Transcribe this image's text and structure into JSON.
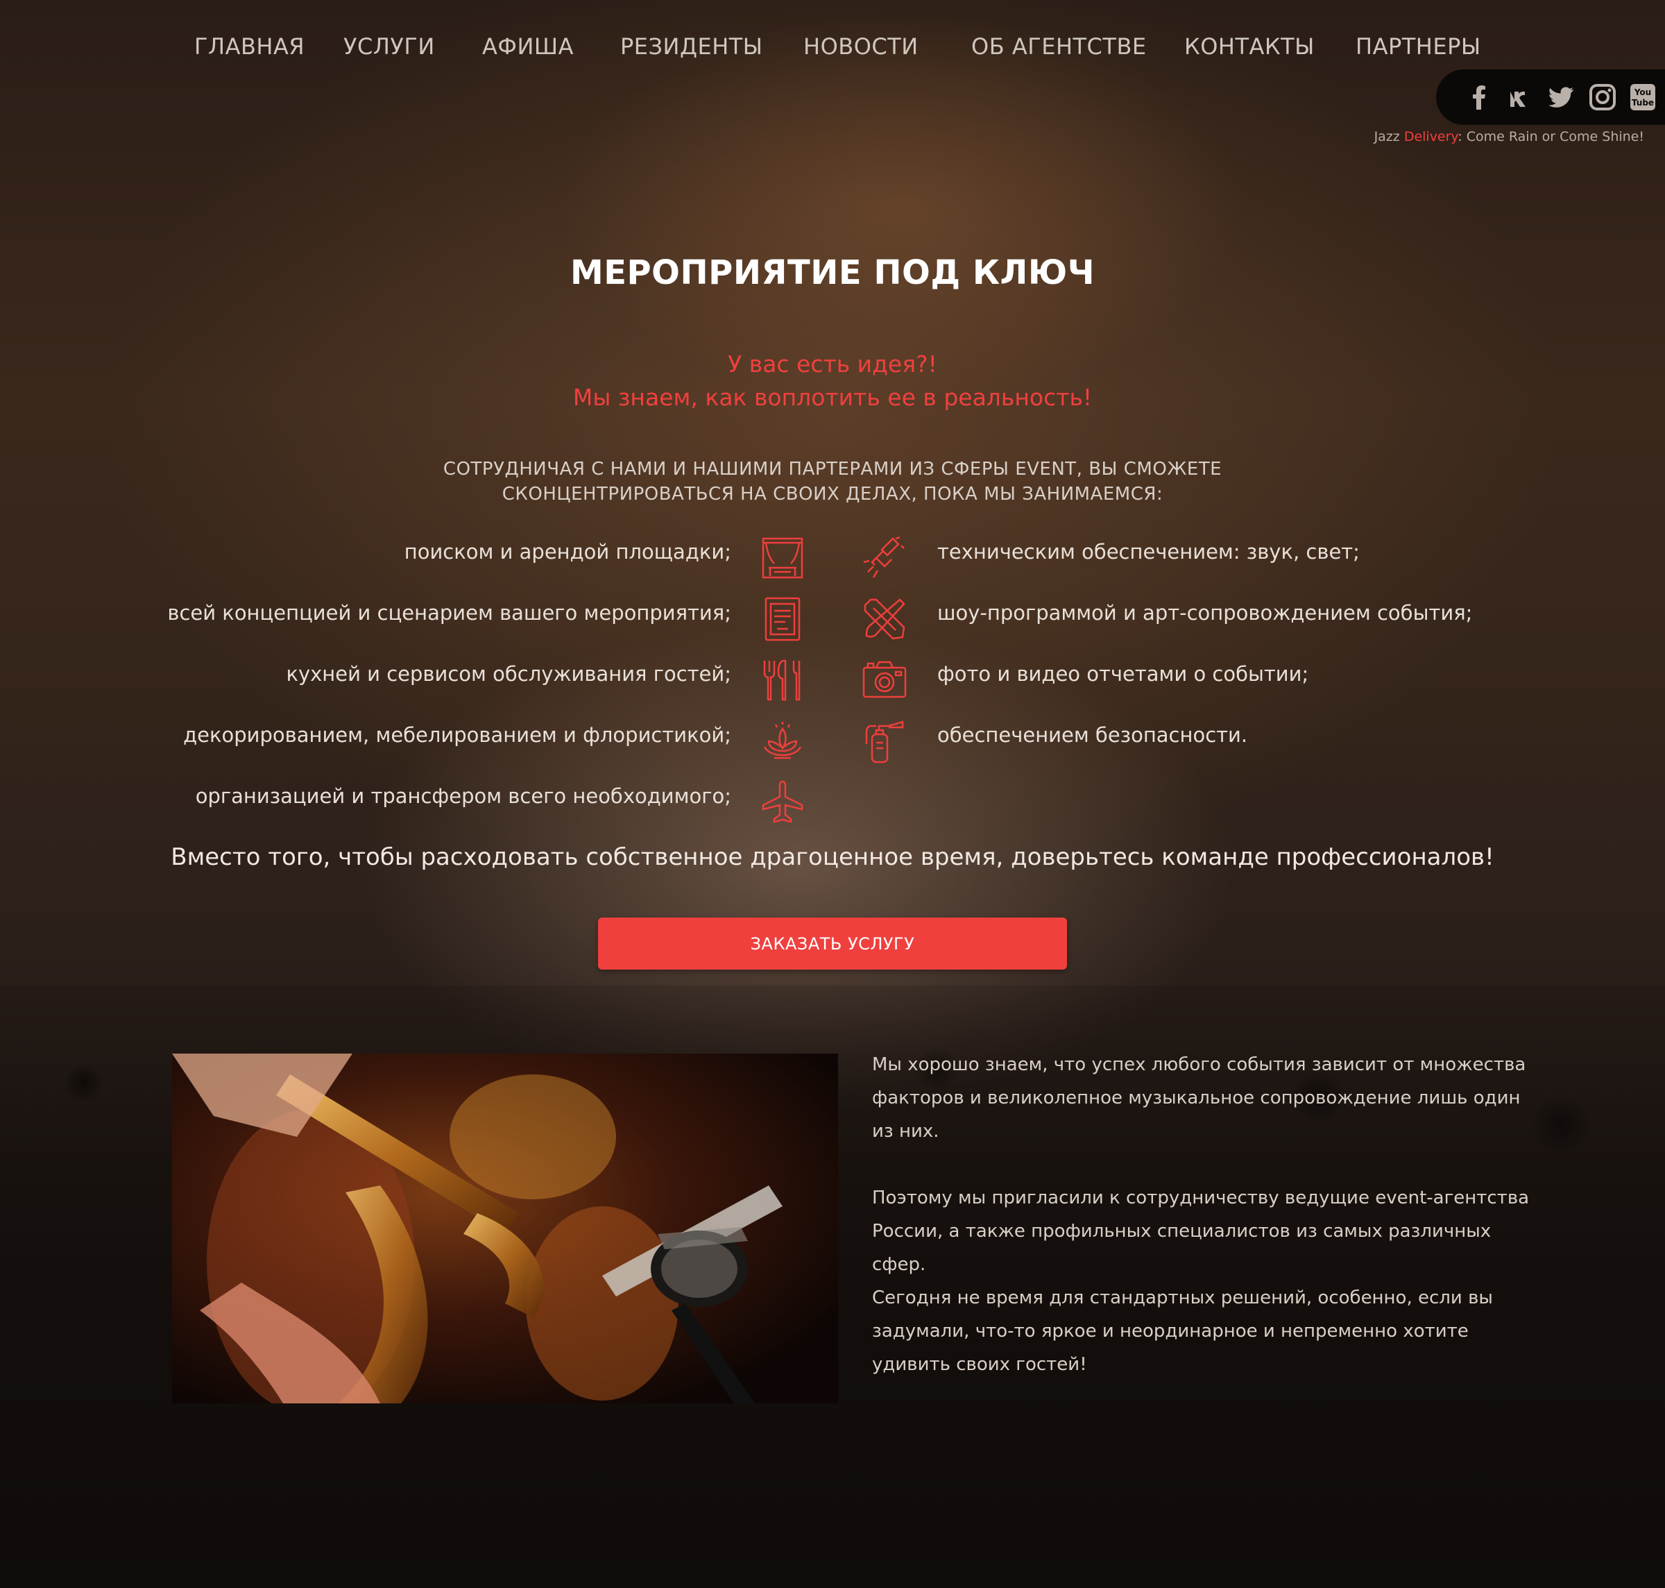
{
  "nav": {
    "items": [
      "ГЛАВНАЯ",
      "УСЛУГИ",
      "АФИША",
      "РЕЗИДЕНТЫ",
      "НОВОСТИ",
      "ОБ АГЕНТСТВЕ",
      "КОНТАКТЫ",
      "ПАРТНЕРЫ"
    ]
  },
  "social": {
    "icons": [
      "facebook-icon",
      "vk-icon",
      "twitter-icon",
      "instagram-icon",
      "youtube-icon"
    ],
    "youtube_label_top": "You",
    "youtube_label_bottom": "Tube"
  },
  "tagline": {
    "part1": "Jazz ",
    "part2": "Delivery",
    "part3": ": Come Rain or Come Shine!"
  },
  "hero": {
    "title": "МЕРОПРИЯТИЕ ПОД КЛЮЧ",
    "lead_line1": "У вас есть идея?!",
    "lead_line2": "Мы знаем, как воплотить ее в реальность!",
    "caps_line1": "СОТРУДНИЧАЯ С НАМИ И НАШИМИ ПАРТЕРАМИ ИЗ СФЕРЫ EVENT, ВЫ СМОЖЕТЕ",
    "caps_line2": "СКОНЦЕНТРИРОВАТЬСЯ НА СВОИХ ДЕЛАХ, ПОКА МЫ ЗАНИМАЕМСЯ:"
  },
  "services": {
    "left": [
      {
        "text": "поиском и арендой площадки;",
        "icon": "stage-icon"
      },
      {
        "text": "всей концепцией и сценарием вашего мероприятия;",
        "icon": "script-book-icon"
      },
      {
        "text": "кухней и сервисом обслуживания гостей;",
        "icon": "cutlery-icon"
      },
      {
        "text": "декорированием, мебелированием и флористикой;",
        "icon": "lotus-icon"
      },
      {
        "text": "организацией и трансфером всего необходимого;",
        "icon": "airplane-icon"
      }
    ],
    "right": [
      {
        "text": "техническим обеспечением: звук, свет;",
        "icon": "spotlight-icon"
      },
      {
        "text": "шоу-программой и арт-сопровождением события;",
        "icon": "brush-pencil-icon"
      },
      {
        "text": "фото и видео отчетами о событии;",
        "icon": "camera-icon"
      },
      {
        "text": "обеспечением безопасности.",
        "icon": "extinguisher-icon"
      }
    ]
  },
  "cta": {
    "text": "Вместо того, чтобы расходовать собственное драгоценное время, доверьтесь команде профессионалов!",
    "button": "ЗАКАЗАТЬ УСЛУГУ"
  },
  "about": {
    "p1": "Мы хорошо знаем, что успех любого события зависит от множества факторов и великолепное музыкальное сопровождение лишь один из них.",
    "p2": "Поэтому мы пригласили к сотрудничеству ведущие event-агентства России, а также профильных специалистов из самых различных сфер.",
    "p3": "Сегодня не время для стандартных решений, особенно, если вы задумали, что-то яркое и неординарное и непременно хотите удивить своих гостей!"
  },
  "colors": {
    "accent": "#f0403e",
    "text": "#e8e0d8",
    "background": "#2a1f19"
  }
}
